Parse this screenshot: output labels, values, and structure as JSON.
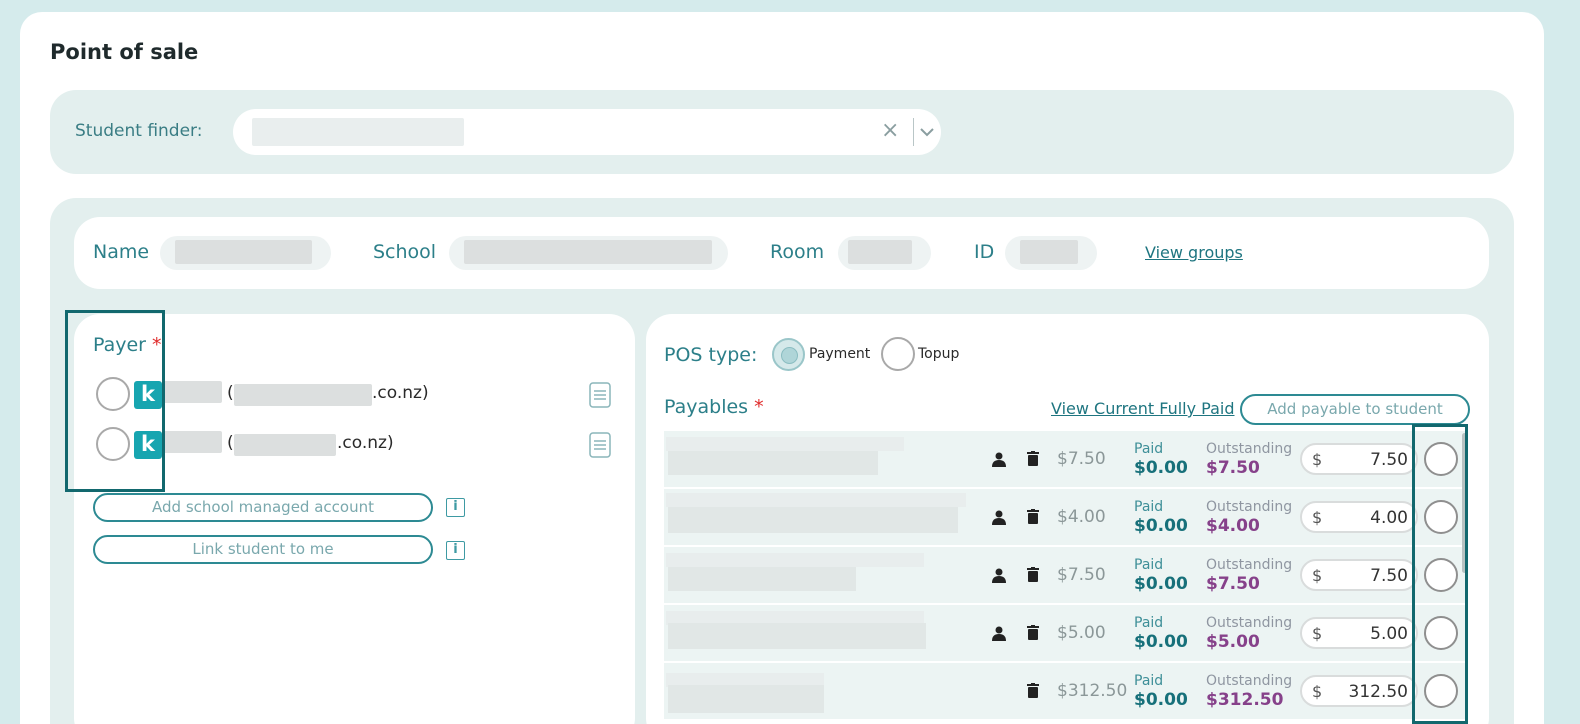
{
  "page": {
    "title": "Point of sale"
  },
  "finder": {
    "label": "Student finder:",
    "clear_icon": "×"
  },
  "student_info": {
    "name_label": "Name",
    "school_label": "School",
    "room_label": "Room",
    "id_label": "ID",
    "view_groups_link": "View groups"
  },
  "payer": {
    "label": "Payer",
    "required_mark": "*",
    "accounts": [
      {
        "badge": "k",
        "email_suffix": ".co.nz)",
        "open_paren": "("
      },
      {
        "badge": "k",
        "email_suffix": ".co.nz)",
        "open_paren": "("
      }
    ],
    "add_school_account_button": "Add school managed account",
    "link_student_button": "Link student to me",
    "info_glyph": "i"
  },
  "pos": {
    "type_label": "POS type:",
    "options": [
      "Payment",
      "Topup"
    ],
    "selected": "Payment"
  },
  "payables": {
    "label": "Payables",
    "required_mark": "*",
    "view_fully_paid_link": "View Current Fully Paid",
    "add_payable_button": "Add payable to student",
    "paid_label": "Paid",
    "outstanding_label": "Outstanding",
    "currency_symbol": "$",
    "rows": [
      {
        "amount": "$7.50",
        "paid": "$0.00",
        "outstanding": "$7.50",
        "input": "7.50",
        "has_person_icon": true
      },
      {
        "amount": "$4.00",
        "paid": "$0.00",
        "outstanding": "$4.00",
        "input": "4.00",
        "has_person_icon": true
      },
      {
        "amount": "$7.50",
        "paid": "$0.00",
        "outstanding": "$7.50",
        "input": "7.50",
        "has_person_icon": true
      },
      {
        "amount": "$5.00",
        "paid": "$0.00",
        "outstanding": "$5.00",
        "input": "5.00",
        "has_person_icon": true
      },
      {
        "amount": "$312.50",
        "paid": "$0.00",
        "outstanding": "$312.50",
        "input": "312.50",
        "has_person_icon": false
      }
    ]
  },
  "colors": {
    "background": "#d5ebec",
    "panel": "#e3efee",
    "teal_text": "#2c7f89",
    "outstanding": "#86418a",
    "highlight_border": "#12686e",
    "badge": "#17a5b0"
  }
}
